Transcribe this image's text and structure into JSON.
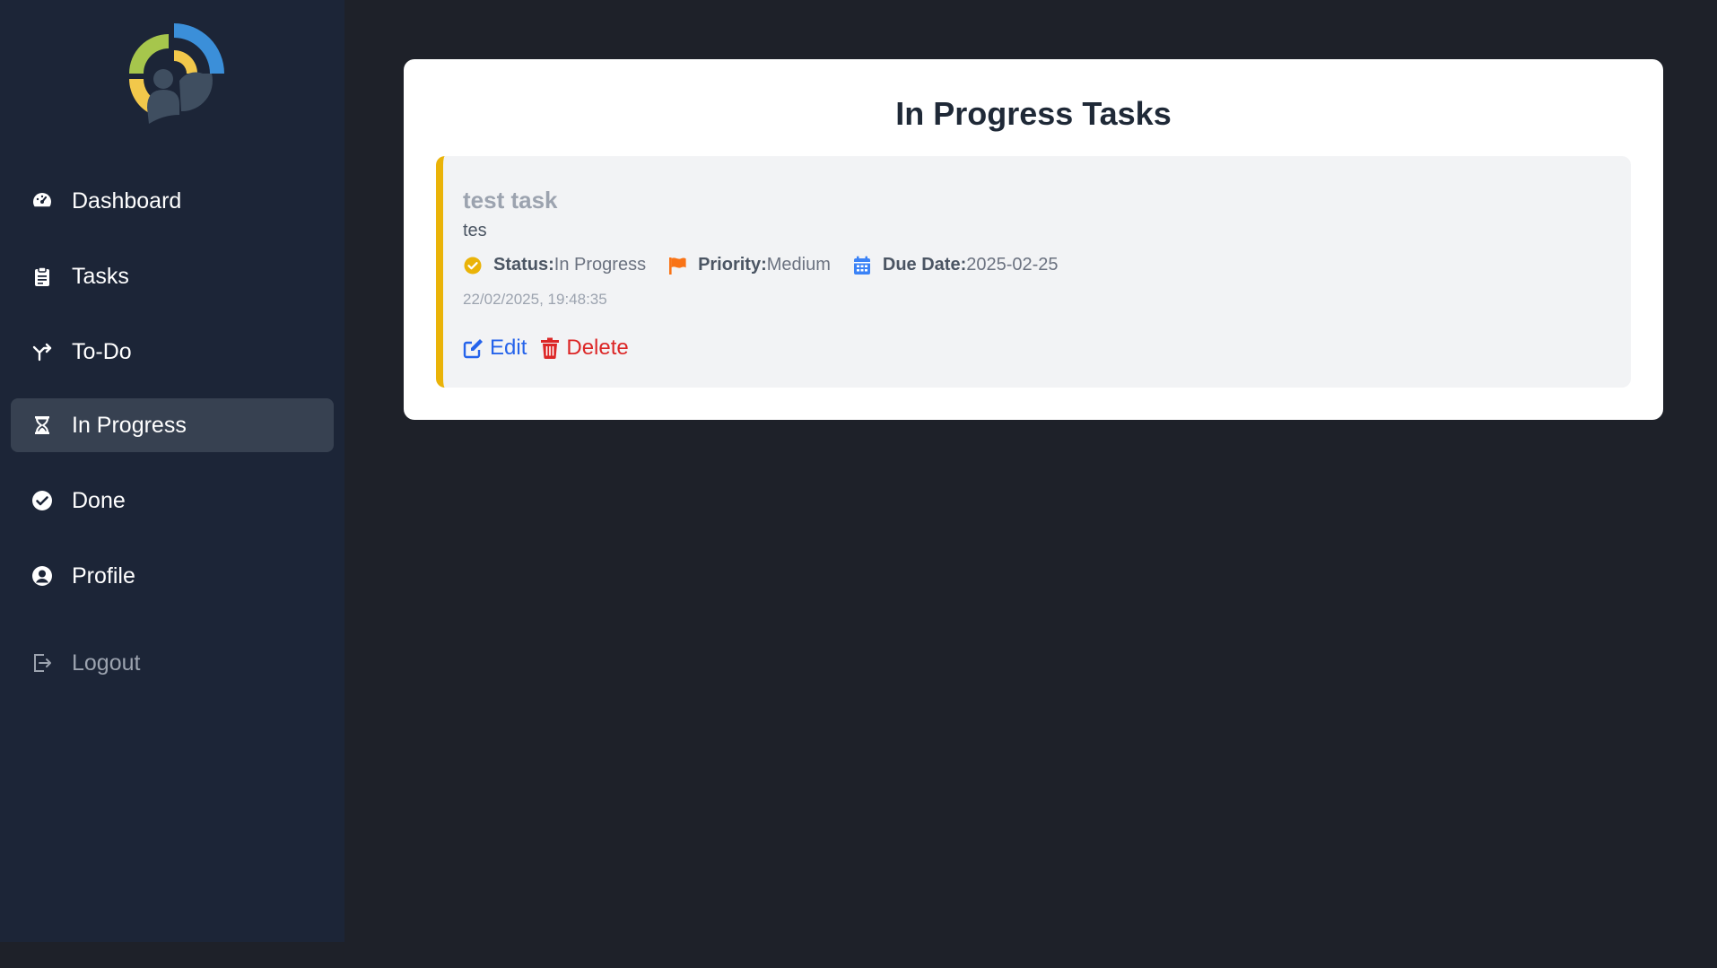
{
  "sidebar": {
    "items": [
      {
        "label": "Dashboard",
        "icon": "gauge-icon"
      },
      {
        "label": "Tasks",
        "icon": "clipboard-icon"
      },
      {
        "label": "To-Do",
        "icon": "branch-arrow-icon"
      },
      {
        "label": "In Progress",
        "icon": "hourglass-icon"
      },
      {
        "label": "Done",
        "icon": "check-circle-icon"
      },
      {
        "label": "Profile",
        "icon": "user-circle-icon"
      }
    ],
    "logout_label": "Logout"
  },
  "main": {
    "title": "In Progress Tasks",
    "tasks": [
      {
        "title": "test task",
        "description": "tes",
        "status_label": "Status:",
        "status_value": "In Progress",
        "priority_label": "Priority:",
        "priority_value": "Medium",
        "due_label": "Due Date:",
        "due_value": "2025-02-25",
        "timestamp": "22/02/2025, 19:48:35",
        "edit_label": "Edit",
        "delete_label": "Delete"
      }
    ]
  },
  "colors": {
    "accent_border": "#eab308",
    "edit": "#2563eb",
    "delete": "#dc2626",
    "priority_flag": "#f97316",
    "calendar": "#3b82f6",
    "sidebar_bg": "#1c2537",
    "active_bg": "#374151"
  }
}
